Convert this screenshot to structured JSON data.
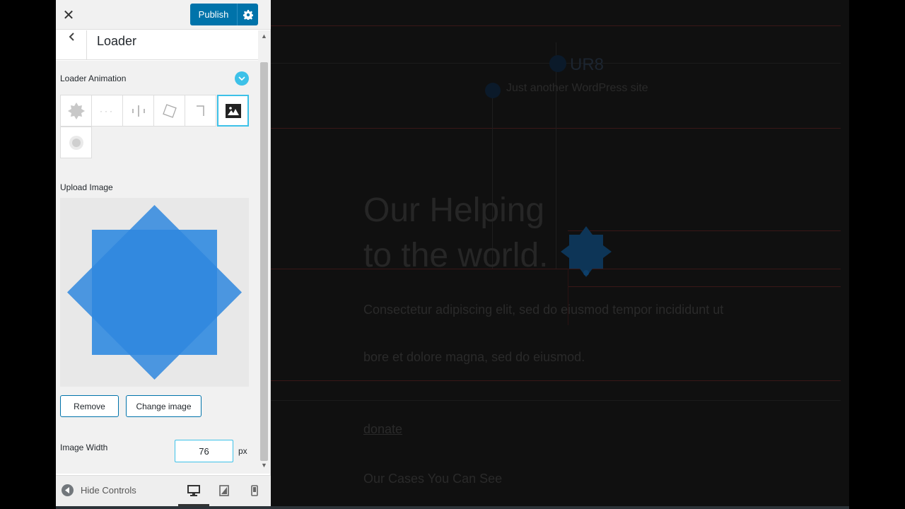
{
  "header": {
    "close_icon": "close-icon",
    "publish_label": "Publish"
  },
  "section": {
    "title": "Loader"
  },
  "loader_animation": {
    "label": "Loader Animation",
    "options": [
      "star-spinner",
      "dots",
      "bars",
      "rotating-square",
      "corner",
      "image",
      "pulse-circle"
    ],
    "selected": "image"
  },
  "upload": {
    "label": "Upload Image",
    "remove_label": "Remove",
    "change_label": "Change image"
  },
  "image_width": {
    "label": "Image Width",
    "value": "76",
    "unit": "px"
  },
  "footer": {
    "hide_controls": "Hide Controls",
    "devices": [
      "desktop",
      "tablet",
      "mobile"
    ],
    "active_device": "desktop"
  },
  "site": {
    "logo_text": "UR8",
    "tagline": "Just another WordPress site",
    "heading_line1": "Our Helping",
    "heading_line2": "to the world.",
    "para1": "Consectetur adipiscing elit, sed do eiusmod tempor incididunt ut",
    "para2": "bore et dolore magna, sed do eiusmod.",
    "link": "donate",
    "subheading": "Our Cases You Can See"
  },
  "colors": {
    "accent": "#3dc1e8",
    "primary": "#0073aa",
    "loader_blue": "#2f8ae0"
  }
}
